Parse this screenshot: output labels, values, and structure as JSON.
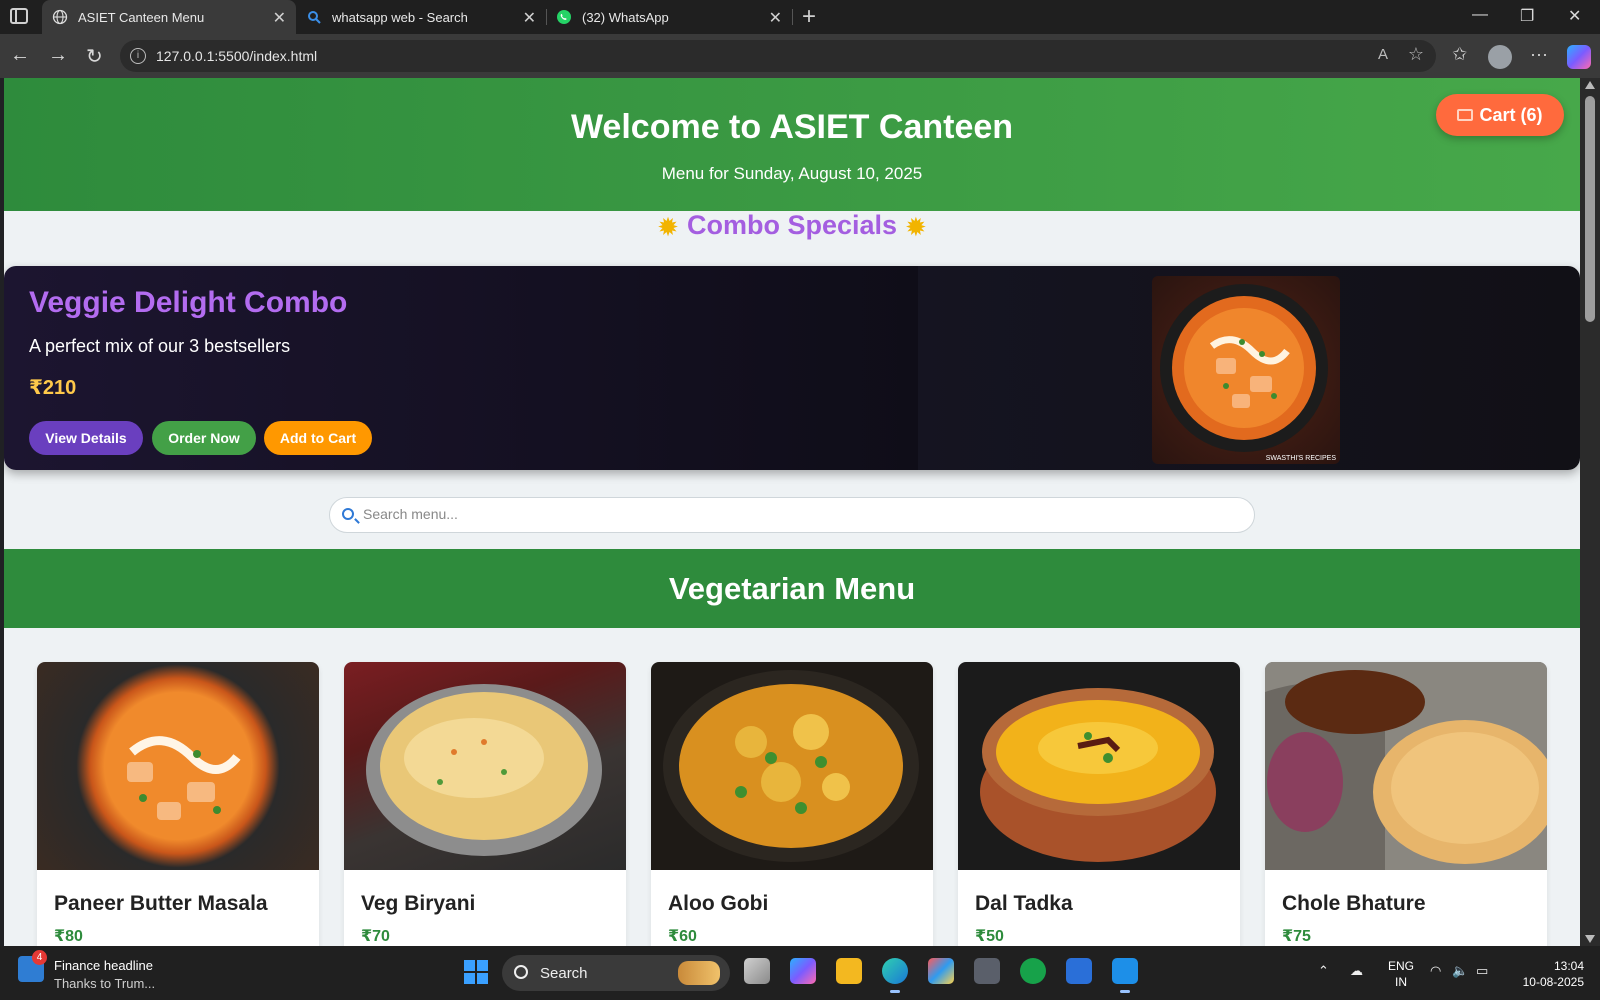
{
  "browser": {
    "tabs": [
      {
        "title": "ASIET Canteen Menu",
        "active": true,
        "icon": "globe-icon"
      },
      {
        "title": "whatsapp web - Search",
        "active": false,
        "icon": "search-icon"
      },
      {
        "title": "(32) WhatsApp",
        "active": false,
        "icon": "whatsapp-icon"
      }
    ],
    "url": "127.0.0.1:5500/index.html"
  },
  "header": {
    "title": "Welcome to ASIET Canteen",
    "date_line": "Menu for Sunday, August 10, 2025",
    "cart_label": "Cart (6)"
  },
  "combo_section": {
    "title": "Combo Specials",
    "combo": {
      "name": "Veggie Delight Combo",
      "description": "A perfect mix of our 3 bestsellers",
      "price": "₹210",
      "view_label": "View Details",
      "order_label": "Order Now",
      "cart_label": "Add to Cart",
      "image_caption": "SWASTHI'S RECIPES"
    }
  },
  "search": {
    "placeholder": "Search menu..."
  },
  "veg_section": {
    "title": "Vegetarian Menu",
    "items": [
      {
        "name": "Paneer Butter Masala",
        "price": "₹80"
      },
      {
        "name": "Veg Biryani",
        "price": "₹70"
      },
      {
        "name": "Aloo Gobi",
        "price": "₹60"
      },
      {
        "name": "Dal Tadka",
        "price": "₹50"
      },
      {
        "name": "Chole Bhature",
        "price": "₹75"
      }
    ]
  },
  "taskbar": {
    "news_title": "Finance headline",
    "news_subtitle": "Thanks to Trum...",
    "news_badge": "4",
    "search_label": "Search",
    "lang_top": "ENG",
    "lang_bottom": "IN",
    "time": "13:04",
    "date": "10-08-2025"
  },
  "colors": {
    "header_green": "#47a84a",
    "combo_purple": "#b36cf0",
    "cart_orange": "#ff6a3d",
    "price_gold": "#ffc94a"
  }
}
